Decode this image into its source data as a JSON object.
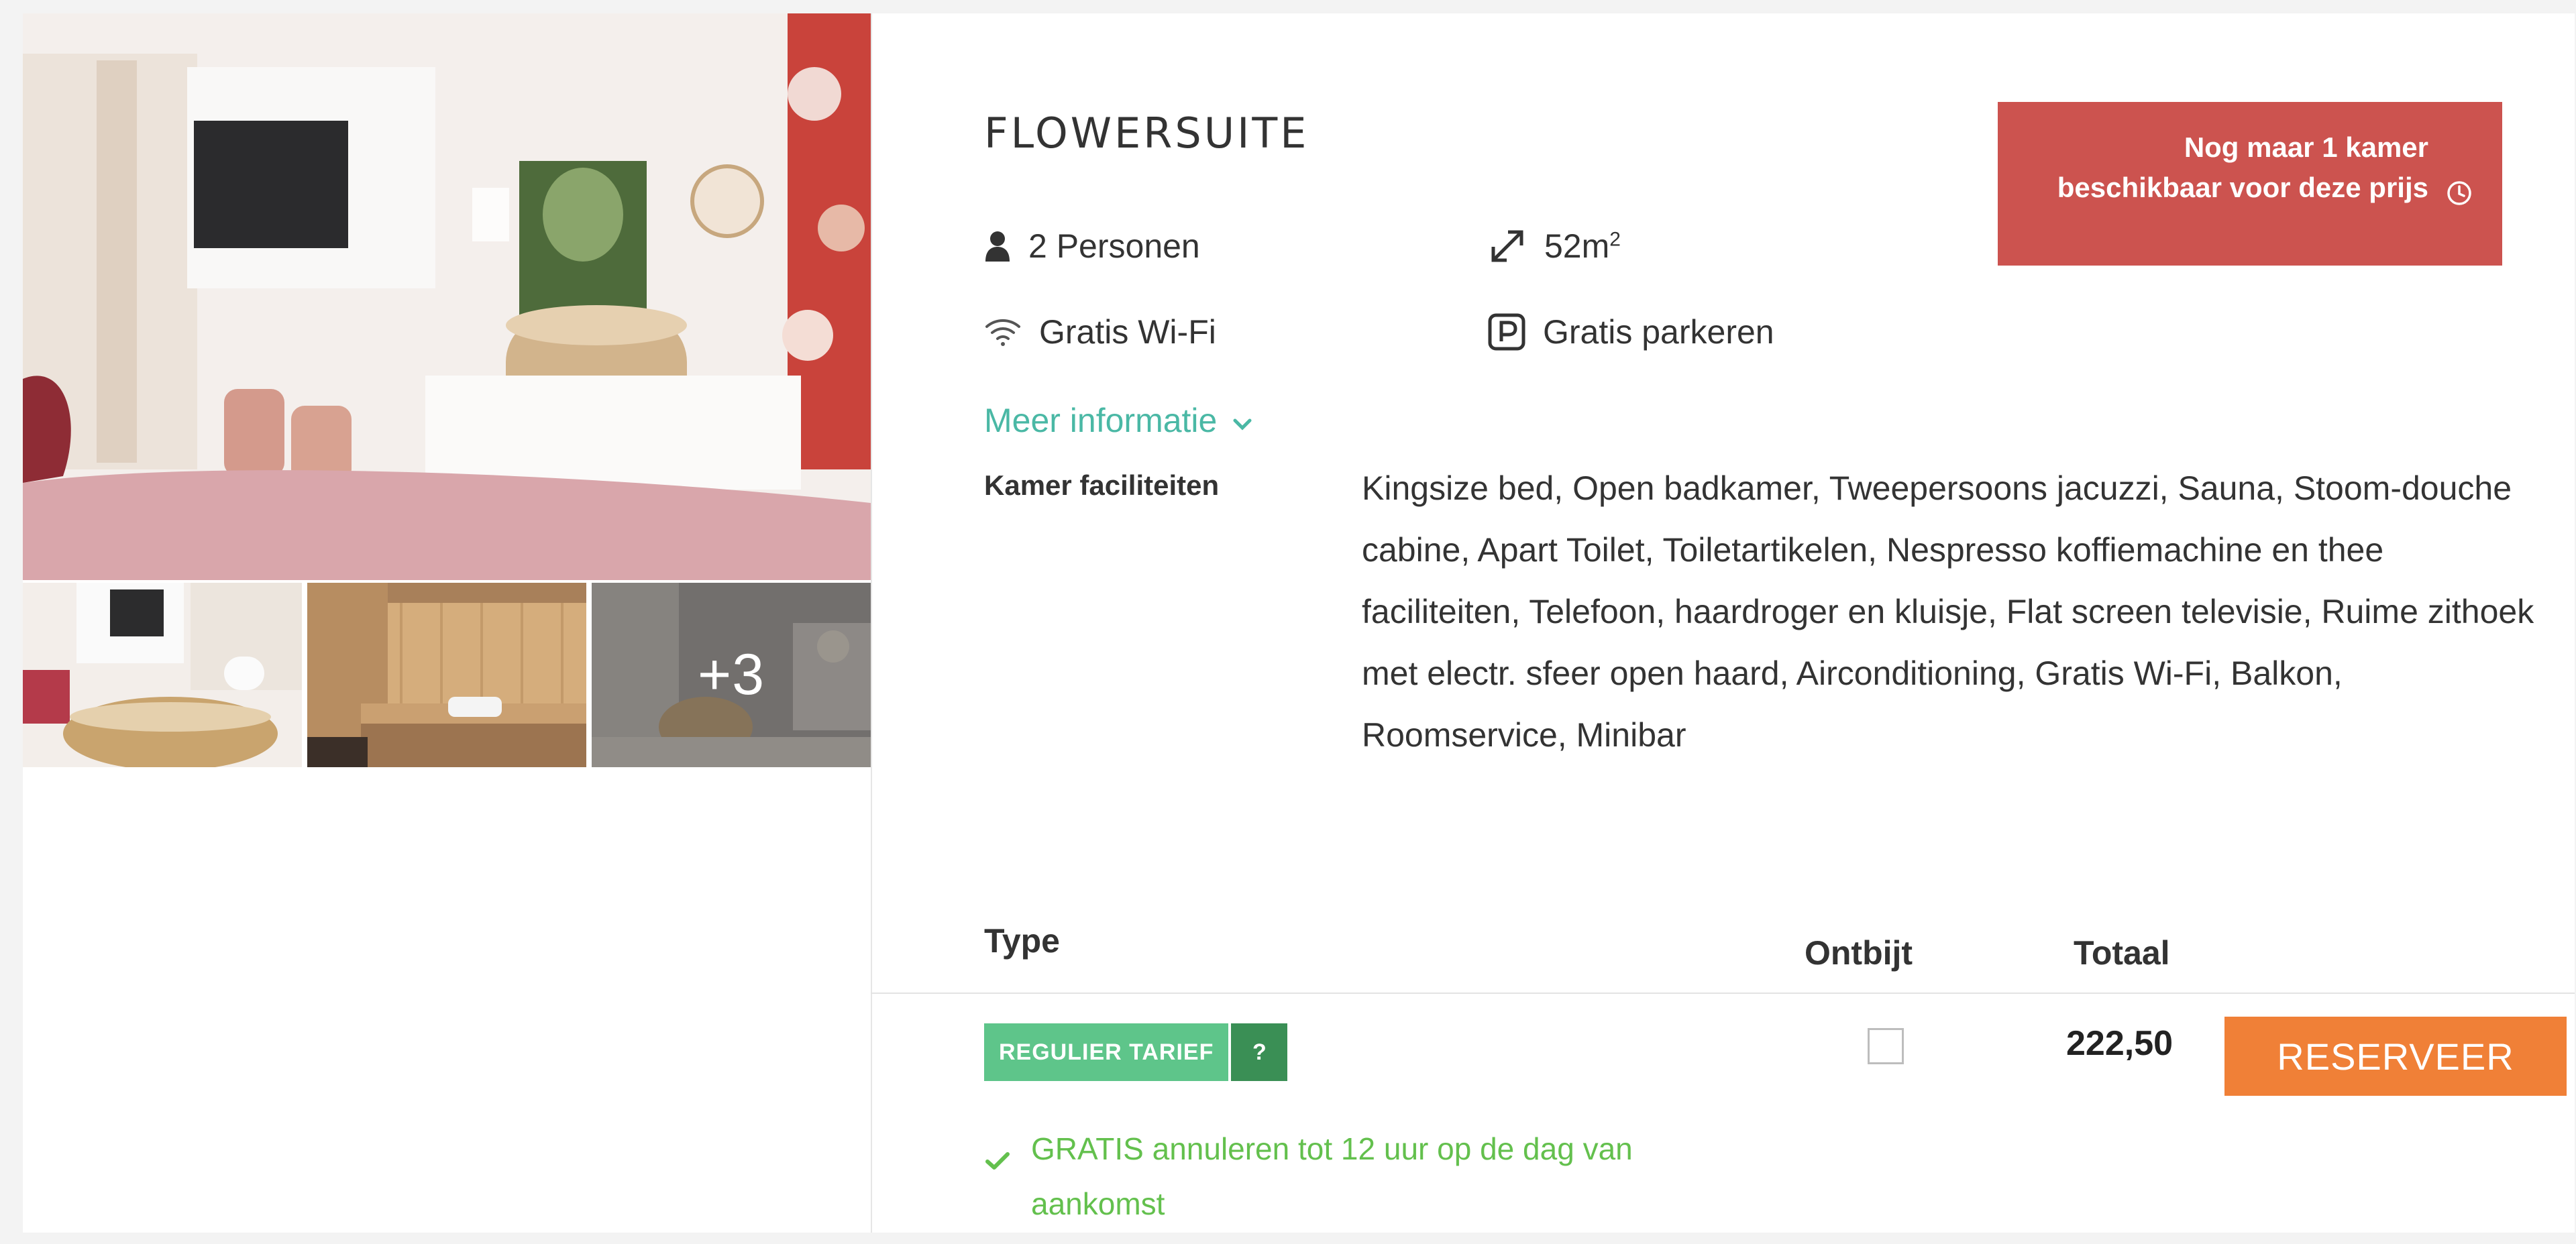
{
  "room": {
    "title": "FLOWERSUITE",
    "persons": "2 Personen",
    "size_value": "52m",
    "size_sup": "2",
    "wifi": "Gratis Wi-Fi",
    "parking": "Gratis parkeren",
    "more_info": "Meer informatie",
    "facilities_label": "Kamer faciliteiten",
    "facilities_text": "Kingsize bed, Open badkamer, Tweepersoons jacuzzi, Sauna, Stoom-douche cabine, Apart Toilet, Toiletartikelen, Nespresso koffiemachine en thee faciliteiten, Telefoon, haardroger en kluisje, Flat screen televisie, Ruime zithoek met electr. sfeer open haard, Airconditioning, Gratis Wi-Fi, Balkon, Roomservice, Minibar"
  },
  "gallery": {
    "more_count": "+3"
  },
  "availability": {
    "text": "Nog maar 1 kamer beschikbaar voor deze prijs"
  },
  "table": {
    "col_type": "Type",
    "col_breakfast": "Ontbijt",
    "col_total": "Totaal"
  },
  "rate": {
    "label": "REGULIER TARIEF",
    "help": "?",
    "breakfast_checked": false,
    "price": "222,50",
    "reserve_label": "RESERVEER",
    "cancellation": "GRATIS annuleren tot 12 uur op de dag van aankomst"
  },
  "colors": {
    "accent_teal": "#4ab8a5",
    "availability_red": "#cc534f",
    "rate_green": "#5ec58a",
    "rate_help_green": "#3a8f55",
    "reserve_orange": "#f08037",
    "cancel_green": "#63c04d"
  },
  "icons": {
    "persons": "person-icon",
    "size": "expand-arrows-icon",
    "wifi": "wifi-icon",
    "parking": "parking-icon",
    "more_info": "chevron-down-icon",
    "availability": "clock-icon",
    "cancellation": "checkmark-icon"
  }
}
